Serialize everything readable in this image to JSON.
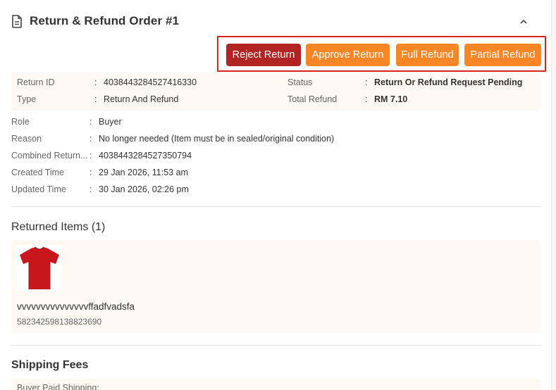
{
  "header": {
    "title": "Return & Refund Order #1"
  },
  "actions": {
    "reject": "Reject Return",
    "approve": "Approve Return",
    "full_refund": "Full Refund",
    "partial_refund": "Partial Refund"
  },
  "summary": {
    "return_id_label": "Return ID",
    "return_id": "4038443284527416330",
    "type_label": "Type",
    "type": "Return And Refund",
    "status_label": "Status",
    "status": "Return Or Refund Request Pending",
    "total_refund_label": "Total Refund",
    "total_refund": "RM 7.10"
  },
  "details": {
    "role_label": "Role",
    "role": "Buyer",
    "reason_label": "Reason",
    "reason": "No longer needed (Item must be in sealed/original condition)",
    "combined_label": "Combined Return...",
    "combined": "4038443284527350794",
    "created_label": "Created Time",
    "created": "29 Jan 2026, 11:53 am",
    "updated_label": "Updated Time",
    "updated": "30 Jan 2026, 02:26 pm",
    "colon": ":"
  },
  "returned_items": {
    "title": "Returned Items (1)",
    "items": [
      {
        "name": "vvvvvvvvvvvvvvvffadfvadsfa",
        "id": "582342598138823690",
        "image_icon": "red-tshirt"
      }
    ]
  },
  "shipping": {
    "title": "Shipping Fees",
    "buyer_paid_label": "Buyer Paid Shipping:"
  },
  "colors": {
    "reject": "#b12422",
    "approve": "#f88627",
    "highlight_frame": "#d9241c",
    "panel_bg": "#fdf8f2"
  }
}
